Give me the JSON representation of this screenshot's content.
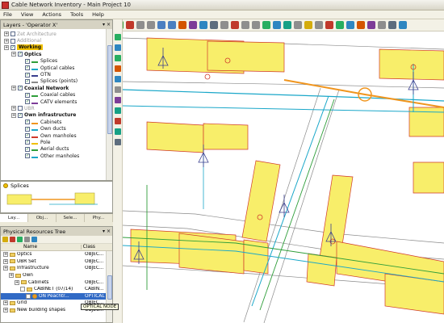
{
  "window": {
    "title": "Cable Network Inventory - Main Project 10"
  },
  "menu": [
    "File",
    "View",
    "Actions",
    "Tools",
    "Help"
  ],
  "layers_panel": {
    "title": "Layers - 'Operator X'",
    "items": [
      {
        "label": "Zet Architecture",
        "level": 0,
        "state": "dim"
      },
      {
        "label": "Additional",
        "level": 0,
        "state": "dim"
      },
      {
        "label": "Working",
        "level": 0,
        "state": "highlight"
      },
      {
        "label": "Optics",
        "level": 1,
        "state": "bold"
      },
      {
        "label": "Splices",
        "level": 2,
        "state": "normal"
      },
      {
        "label": "Optical cables",
        "level": 2,
        "state": "normal"
      },
      {
        "label": "OTN",
        "level": 2,
        "state": "normal"
      },
      {
        "label": "Splices (points)",
        "level": 2,
        "state": "normal"
      },
      {
        "label": "Coaxial Network",
        "level": 1,
        "state": "bold"
      },
      {
        "label": "Coaxial cables",
        "level": 2,
        "state": "normal"
      },
      {
        "label": "CATV elements",
        "level": 2,
        "state": "normal"
      },
      {
        "label": "UBR",
        "level": 1,
        "state": "dim"
      },
      {
        "label": "Own infrastructure",
        "level": 1,
        "state": "bold"
      },
      {
        "label": "Cabinets",
        "level": 2,
        "state": "normal"
      },
      {
        "label": "Own ducts",
        "level": 2,
        "state": "normal"
      },
      {
        "label": "Own manholes",
        "level": 2,
        "state": "normal"
      },
      {
        "label": "Pole",
        "level": 2,
        "state": "normal"
      },
      {
        "label": "Aerial ducts",
        "level": 2,
        "state": "normal"
      },
      {
        "label": "Other manholes",
        "level": 2,
        "state": "normal"
      }
    ]
  },
  "legend": {
    "label": "Splices"
  },
  "tabs": [
    "Lay...",
    "Obj...",
    "Sele...",
    "Phy..."
  ],
  "resources_panel": {
    "title": "Physical Resources Tree",
    "columns": [
      "Name",
      "Class"
    ],
    "rows": [
      {
        "name": "Optics",
        "class": "OBJEC...",
        "level": 0
      },
      {
        "name": "UBR Set",
        "class": "OBJEC...",
        "level": 0
      },
      {
        "name": "Infrastructure",
        "class": "OBJEC...",
        "level": 0
      },
      {
        "name": "Own",
        "class": "",
        "level": 1
      },
      {
        "name": "Cabinets",
        "class": "OBJEC...",
        "level": 2
      },
      {
        "name": "CABINET (07/14)",
        "class": "CABIN...",
        "level": 3
      },
      {
        "name": "ON Peachtr...",
        "class": "OPTICAL NODE",
        "level": 4
      },
      {
        "name": "Grid",
        "class": "OBJEC...",
        "level": 0
      },
      {
        "name": "New building shapes",
        "class": "OBJEC...",
        "level": 0
      }
    ],
    "tooltip": "OPTICAL NODE"
  },
  "colors": {
    "building": "#f8ee6a",
    "building_border": "#d0392a",
    "cable_cyan": "#1aa7c9",
    "cable_green": "#2f9e3a",
    "cable_orange": "#f0951e",
    "road": "#8a8a8a"
  }
}
